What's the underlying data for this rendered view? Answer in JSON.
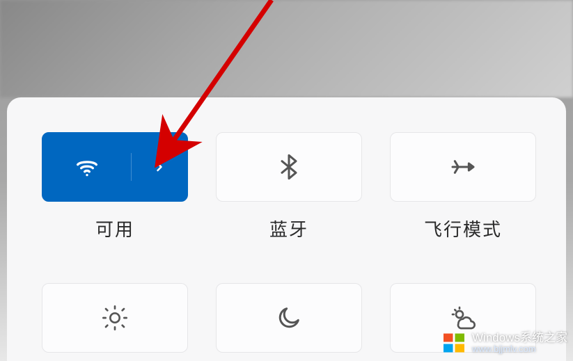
{
  "quick_settings": {
    "tiles": [
      {
        "id": "wifi",
        "label": "可用",
        "icon": "wifi-icon",
        "active": true,
        "expandable": true
      },
      {
        "id": "bluetooth",
        "label": "蓝牙",
        "icon": "bluetooth-icon",
        "active": false
      },
      {
        "id": "airplane",
        "label": "飞行模式",
        "icon": "airplane-icon",
        "active": false
      }
    ],
    "row2": [
      {
        "id": "brightness",
        "icon": "sun-icon"
      },
      {
        "id": "nightlight",
        "icon": "moon-icon"
      },
      {
        "id": "nearby",
        "icon": "cloud-sun-icon"
      }
    ]
  },
  "annotation": {
    "arrow_color": "#d40000"
  },
  "watermark": {
    "line1": "Windows系统之家",
    "line2": "www.bjjmlv.com"
  }
}
